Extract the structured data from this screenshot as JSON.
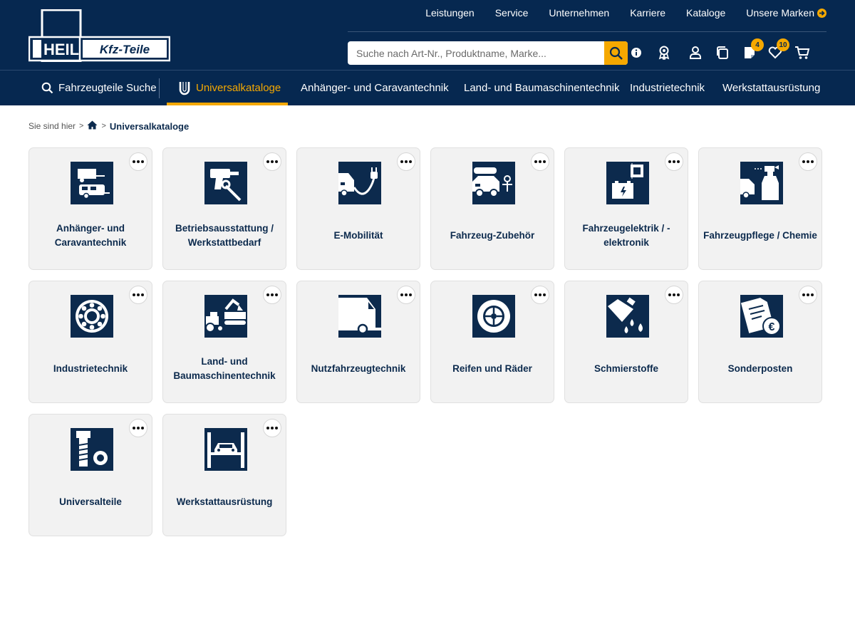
{
  "logo": {
    "left_text": "HEIL",
    "right_text": "Kfz-Teile"
  },
  "topnav": [
    {
      "label": "Leistungen"
    },
    {
      "label": "Service"
    },
    {
      "label": "Unternehmen"
    },
    {
      "label": "Karriere"
    },
    {
      "label": "Kataloge"
    },
    {
      "label": "Unsere Marken"
    }
  ],
  "search": {
    "placeholder": "Suche nach Art-Nr., Produktname, Marke..."
  },
  "header_icons": {
    "notepad_count": "4",
    "wishlist_count": "10"
  },
  "subnav": [
    {
      "label": "Fahrzeugteile Suche"
    },
    {
      "label": "Universalkataloge"
    },
    {
      "label": "Anhänger- und Caravantechnik"
    },
    {
      "label": "Land- und Baumaschinentechnik"
    },
    {
      "label": "Industrietechnik"
    },
    {
      "label": "Werkstattausrüstung"
    }
  ],
  "breadcrumb": {
    "prefix": "Sie sind hier",
    "separator": ">",
    "current": "Universalkataloge"
  },
  "categories": [
    {
      "label": "Anhänger- und Caravantechnik",
      "icon": "trailer-caravan-icon"
    },
    {
      "label": "Betriebsausstattung / Werkstattbedarf",
      "icon": "drill-wrench-icon"
    },
    {
      "label": "E-Mobilität",
      "icon": "electric-car-plug-icon"
    },
    {
      "label": "Fahrzeug-Zubehör",
      "icon": "car-roofbox-icon"
    },
    {
      "label": "Fahrzeugelektrik / -elektronik",
      "icon": "battery-chip-icon"
    },
    {
      "label": "Fahrzeugpflege / Chemie",
      "icon": "car-spray-bottle-icon"
    },
    {
      "label": "Industrietechnik",
      "icon": "ball-bearing-icon"
    },
    {
      "label": "Land- und Baumaschinentechnik",
      "icon": "tractor-excavator-icon"
    },
    {
      "label": "Nutzfahrzeugtechnik",
      "icon": "truck-icon"
    },
    {
      "label": "Reifen und Räder",
      "icon": "tire-wheel-icon"
    },
    {
      "label": "Schmierstoffe",
      "icon": "oil-can-drops-icon"
    },
    {
      "label": "Sonderposten",
      "icon": "document-euro-icon"
    },
    {
      "label": "Universalteile",
      "icon": "bolt-nut-icon"
    },
    {
      "label": "Werkstattausrüstung",
      "icon": "car-lift-icon"
    }
  ],
  "colors": {
    "navy": "#062850",
    "accent": "#f5a800",
    "card_bg": "#f2f2f2",
    "text": "#0c2a4d"
  }
}
